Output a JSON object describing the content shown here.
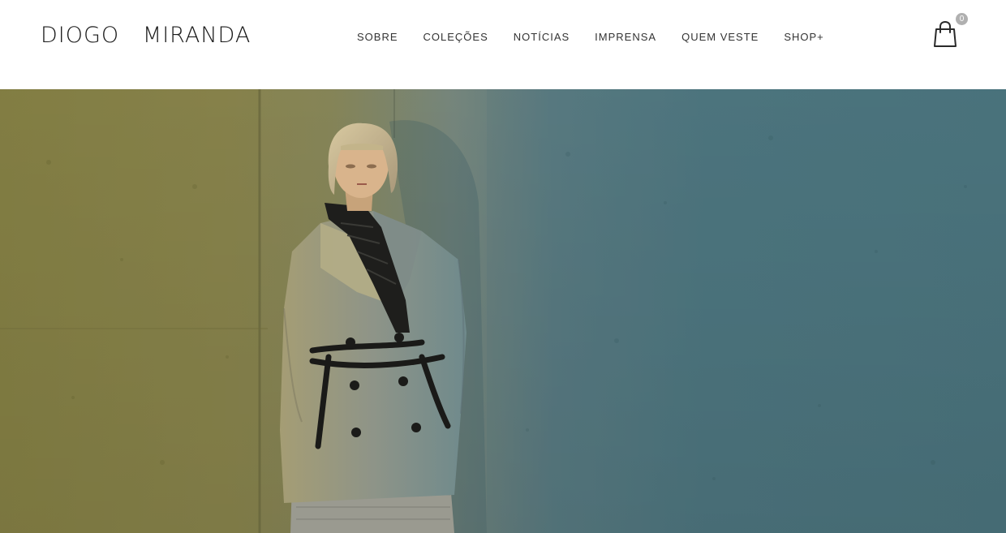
{
  "header": {
    "logo": "DIOGO   MIRANDA",
    "nav": [
      {
        "label": "SOBRE"
      },
      {
        "label": "COLEÇÕES"
      },
      {
        "label": "NOTÍCIAS"
      },
      {
        "label": "IMPRENSA"
      },
      {
        "label": "QUEM VESTE"
      },
      {
        "label": "SHOP+"
      }
    ],
    "cart": {
      "icon": "shopping-bag-icon",
      "count": "0"
    }
  },
  "hero": {
    "image": "fashion-model-photo",
    "colors": {
      "left_wall": "#8a8548",
      "right_wall": "#4f7a83",
      "coat": "#8e9488"
    }
  }
}
